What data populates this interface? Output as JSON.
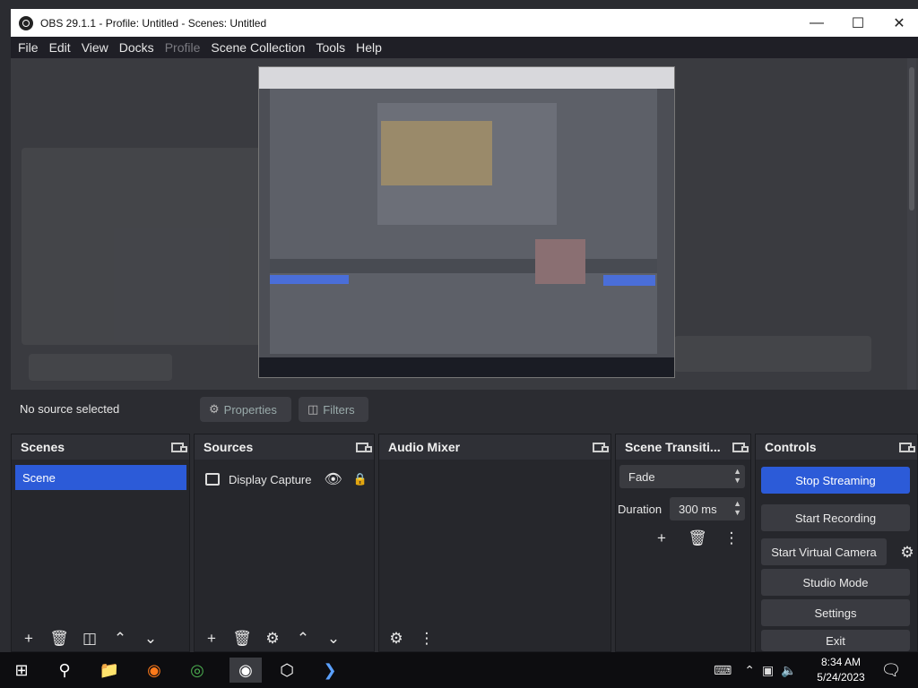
{
  "window": {
    "title": "OBS 29.1.1 - Profile: Untitled - Scenes: Untitled",
    "minimize_icon": "minimize-icon",
    "maximize_icon": "maximize-icon",
    "close_icon": "close-icon"
  },
  "menu": {
    "items": [
      "File",
      "Edit",
      "View",
      "Docks",
      "Profile",
      "Scene Collection",
      "Tools",
      "Help"
    ]
  },
  "properties_bar": {
    "no_source": "No source selected",
    "properties_label": "Properties",
    "filters_label": "Filters"
  },
  "scenes": {
    "title": "Scenes",
    "items": [
      "Scene"
    ]
  },
  "sources": {
    "title": "Sources",
    "items": [
      {
        "label": "Display Capture",
        "visible_icon": "eye-icon",
        "lock_icon": "lock-icon"
      }
    ]
  },
  "audio_mixer": {
    "title": "Audio Mixer"
  },
  "transitions": {
    "title": "Scene Transiti...",
    "selected": "Fade",
    "duration_label": "Duration",
    "duration_value": "300 ms"
  },
  "controls": {
    "title": "Controls",
    "stop_streaming": "Stop Streaming",
    "start_recording": "Start Recording",
    "start_virtual_camera": "Start Virtual Camera",
    "studio_mode": "Studio Mode",
    "settings": "Settings",
    "exit": "Exit"
  },
  "taskbar": {
    "time": "8:34 AM",
    "date": "5/24/2023"
  },
  "colors": {
    "accent": "#2c5bd8",
    "dock_bg": "#26272c",
    "background": "#2b2c31"
  }
}
